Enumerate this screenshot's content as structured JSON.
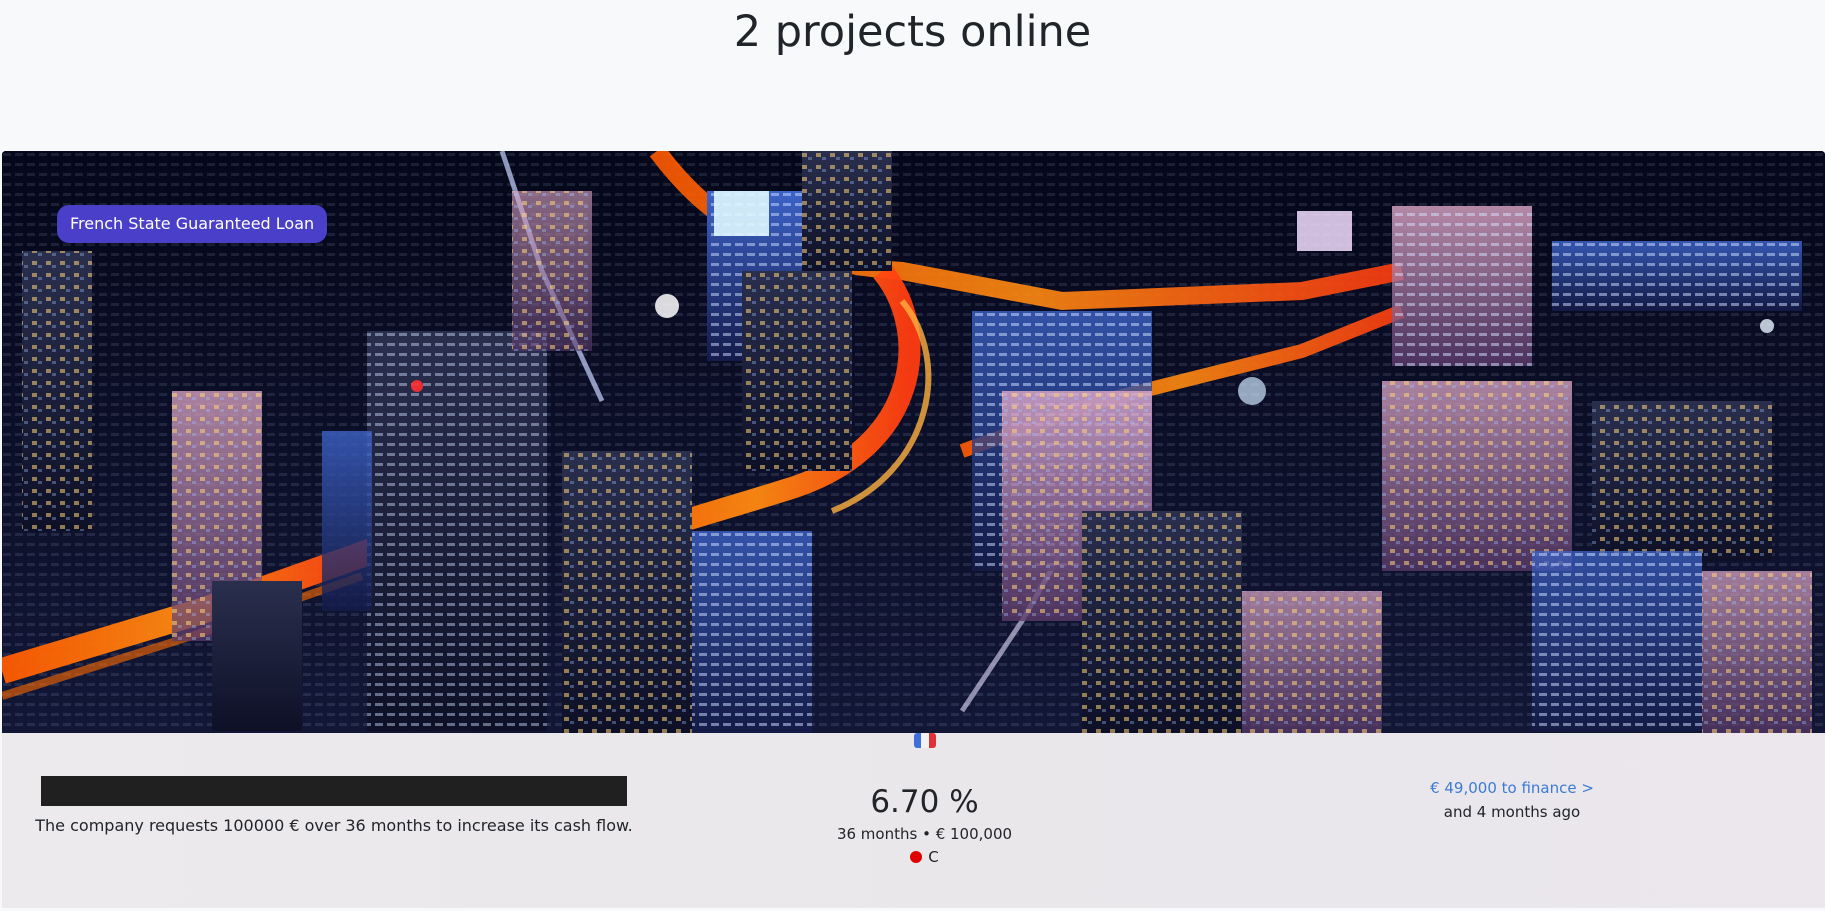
{
  "page": {
    "title": "2 projects online"
  },
  "project": {
    "category_badge": "French State Guaranteed Loan",
    "image_alt_icon": "city-night-aerial-image",
    "country_flag_icon": "france-flag-icon",
    "flag_colors": [
      "#3f6fd8",
      "#f2f2f2",
      "#e0313a"
    ],
    "name_redacted": true,
    "description": "The company requests 100000 € over 36 months to increase its cash flow.",
    "rate": "6.70 %",
    "terms": "36 months • € 100,000",
    "risk_grade": "C",
    "risk_color": "#e00000",
    "finance_link": "€ 49,000 to finance >",
    "time_ago": "and 4 months ago"
  },
  "colors": {
    "badge_bg": "#4a3fc8",
    "link": "#3a7bd5",
    "text": "#212529"
  }
}
